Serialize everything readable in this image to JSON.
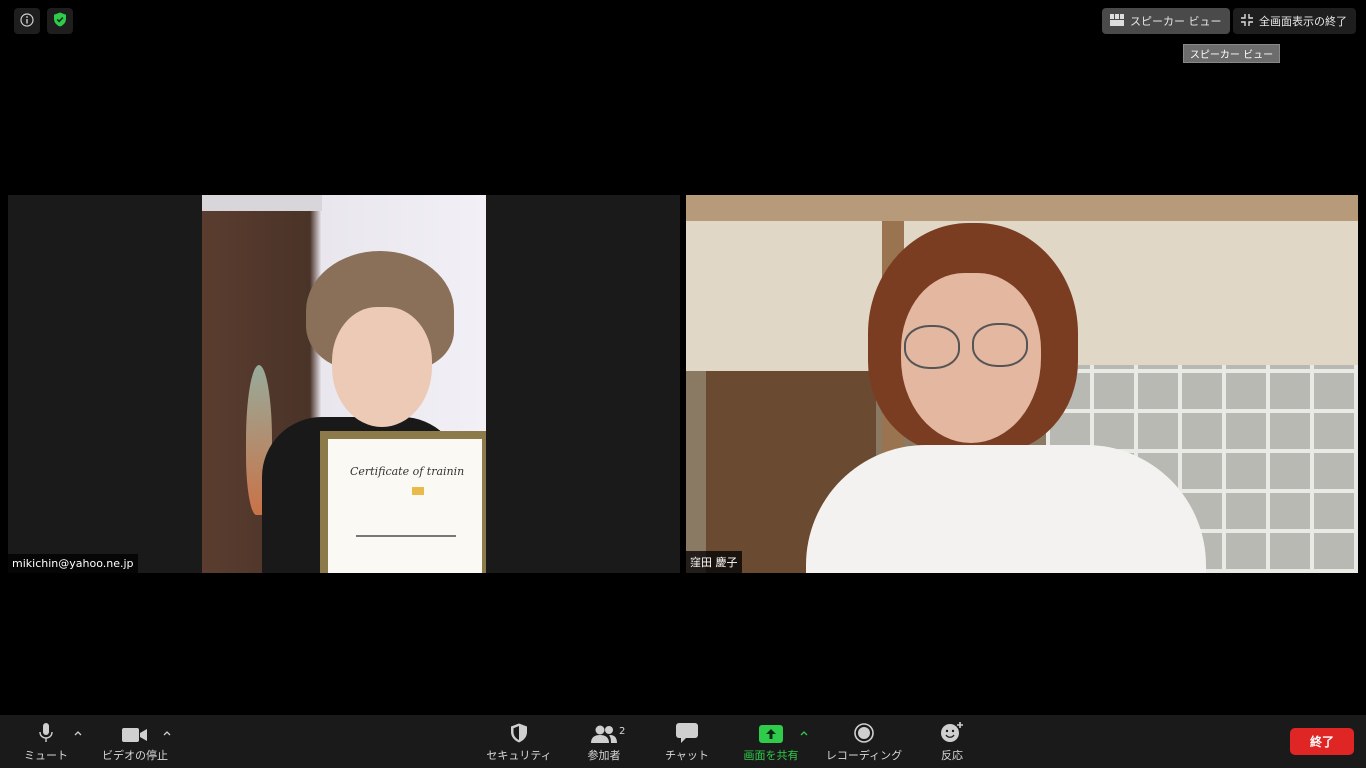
{
  "top_right": {
    "speaker_view_label": "スピーカー ビュー",
    "exit_fullscreen_label": "全画面表示の終了",
    "tooltip": "スピーカー ビュー"
  },
  "participants": [
    {
      "name": "mikichin@yahoo.ne.jp"
    },
    {
      "name": "窪田 慶子"
    }
  ],
  "left_video": {
    "certificate_title": "Certificate of trainin"
  },
  "toolbar": {
    "mute_label": "ミュート",
    "video_label": "ビデオの停止",
    "security_label": "セキュリティ",
    "participants_label": "参加者",
    "participants_count": "2",
    "chat_label": "チャット",
    "share_label": "画面を共有",
    "record_label": "レコーディング",
    "reactions_label": "反応",
    "end_label": "終了"
  },
  "colors": {
    "background": "#000000",
    "toolbar": "#1a1a1a",
    "share_green": "#2ecc4a",
    "end_red": "#e02525",
    "shield_green": "#2ecc4a"
  }
}
